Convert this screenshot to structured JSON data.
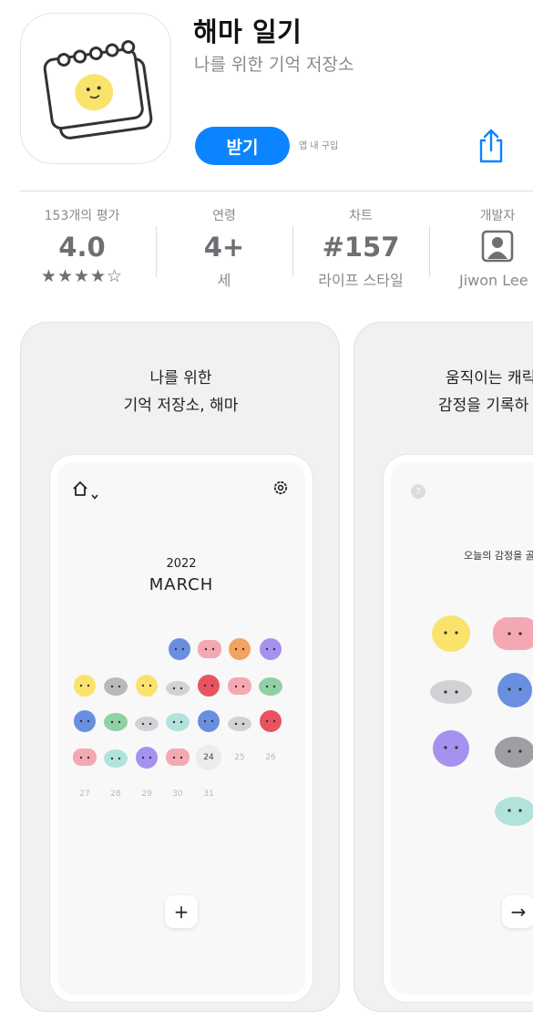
{
  "app": {
    "title": "해마 일기",
    "subtitle": "나를 위한 기억 저장소",
    "get_label": "받기",
    "iap_label": "앱 내 구입"
  },
  "info": {
    "ratings": {
      "label": "153개의 평가",
      "value": "4.0",
      "stars": "★★★★☆",
      "rating_fraction": 0.8
    },
    "age": {
      "label": "연령",
      "value": "4+",
      "sub": "세"
    },
    "chart": {
      "label": "차트",
      "value": "#157",
      "sub": "라이프 스타일"
    },
    "developer": {
      "label": "개발자",
      "sub": "Jiwon Lee"
    }
  },
  "screenshots": [
    {
      "caption_line1": "나를 위한",
      "caption_line2": "기억 저장소, 해마",
      "calendar": {
        "year": "2022",
        "month": "MARCH",
        "today": "24",
        "later_days": [
          "25",
          "26",
          "27",
          "28",
          "29",
          "30",
          "31"
        ],
        "add_label": "+"
      }
    },
    {
      "caption_line1": "움직이는 캐릭",
      "caption_line2": "감정을 기록하",
      "question": "?",
      "prompt": "오늘의 감정을 골라",
      "next_label": "→"
    }
  ],
  "colors": {
    "accent": "#0a84ff",
    "blue": "#6a8fe0",
    "pink": "#f4a9b2",
    "orange": "#f1a35f",
    "purple": "#a592f0",
    "yellow": "#f9e36c",
    "gray": "#b9b9bd",
    "red": "#e8535f",
    "green": "#8fd0a5",
    "mint": "#b2e2dc"
  },
  "icons": [
    "home-icon",
    "chevron-down-icon",
    "gear-icon",
    "share-icon",
    "person-icon",
    "plus-icon",
    "arrow-right-icon",
    "question-icon"
  ]
}
